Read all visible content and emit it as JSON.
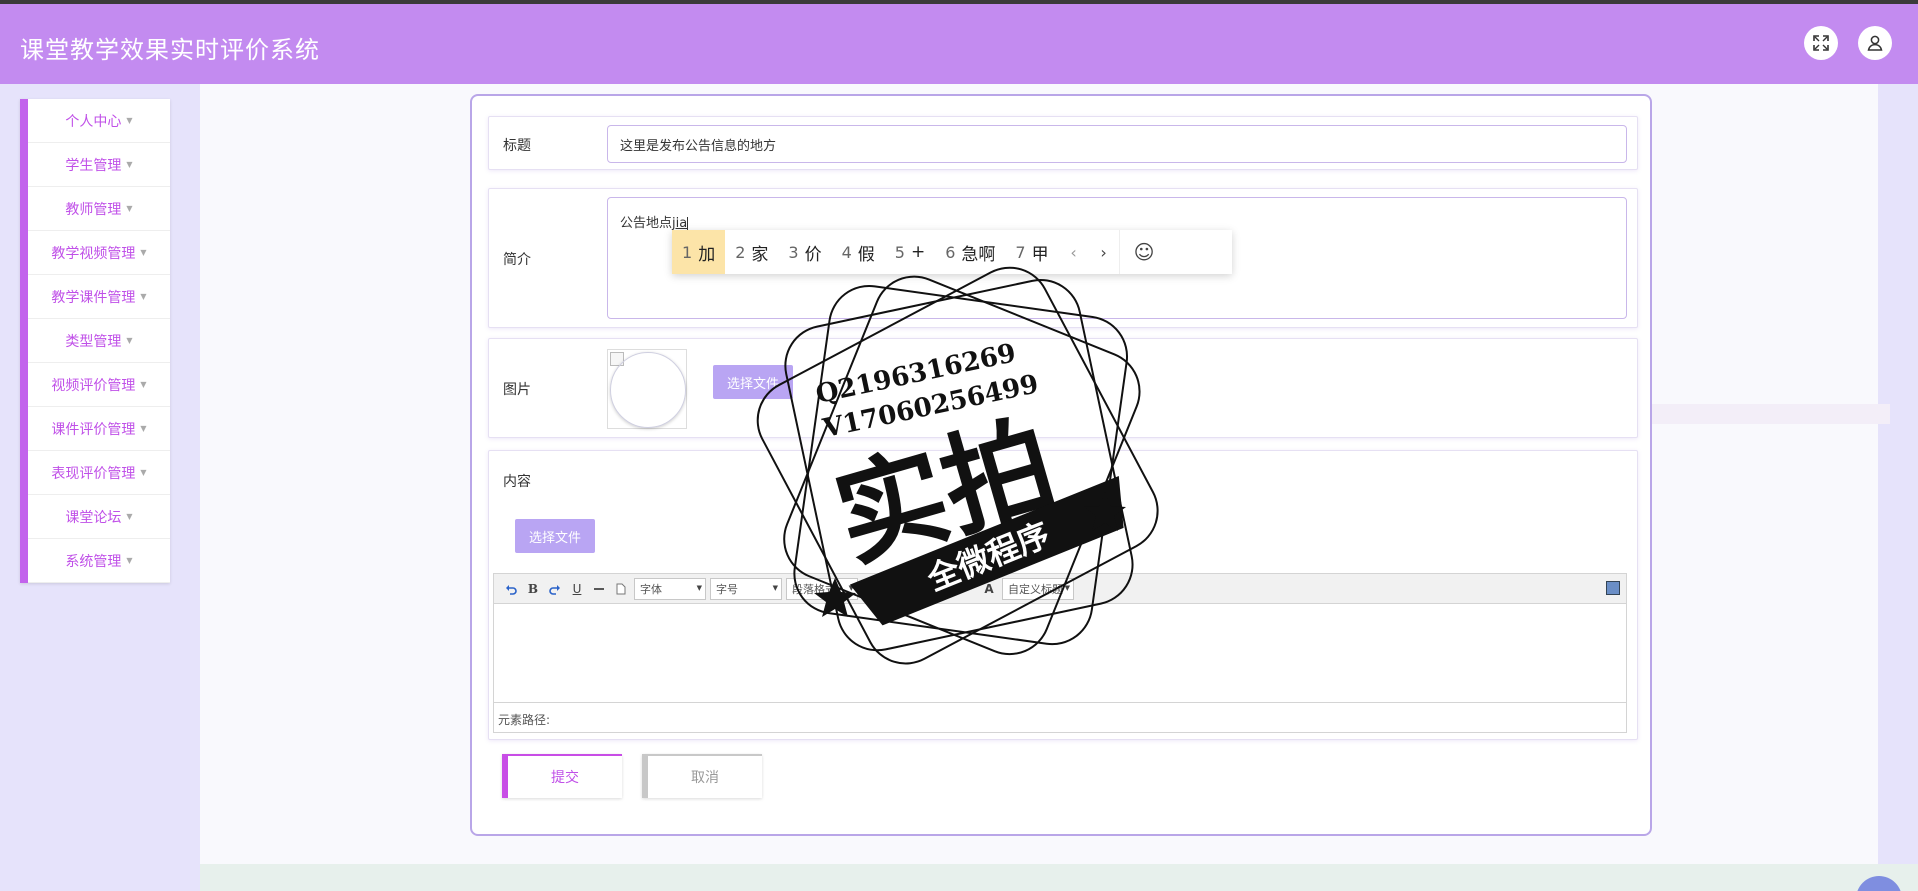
{
  "app": {
    "title": "课堂教学效果实时评价系统"
  },
  "sidebar": {
    "items": [
      {
        "label": "个人中心"
      },
      {
        "label": "学生管理"
      },
      {
        "label": "教师管理"
      },
      {
        "label": "教学视频管理"
      },
      {
        "label": "教学课件管理"
      },
      {
        "label": "类型管理"
      },
      {
        "label": "视频评价管理"
      },
      {
        "label": "课件评价管理"
      },
      {
        "label": "表现评价管理"
      },
      {
        "label": "课堂论坛"
      },
      {
        "label": "系统管理"
      }
    ]
  },
  "form": {
    "title_label": "标题",
    "title_value": "这里是发布公告信息的地方",
    "intro_label": "简介",
    "intro_value": "公告地点",
    "intro_typing": "jia",
    "image_label": "图片",
    "image_button": "选择文件",
    "content_label": "内容",
    "content_button": "选择文件",
    "submit_label": "提交",
    "cancel_label": "取消"
  },
  "editor": {
    "font_select": "字体",
    "size_select": "字号",
    "paragraph_select": "段落格式",
    "custom_heading_select": "自定义标题",
    "status_text": "元素路径:"
  },
  "ime": {
    "candidates": [
      {
        "num": "1",
        "text": "加"
      },
      {
        "num": "2",
        "text": "家"
      },
      {
        "num": "3",
        "text": "价"
      },
      {
        "num": "4",
        "text": "假"
      },
      {
        "num": "5",
        "text": "+"
      },
      {
        "num": "6",
        "text": "急啊"
      },
      {
        "num": "7",
        "text": "甲"
      }
    ],
    "selected_index": 0
  },
  "watermark": {
    "line1": "Q2196316269",
    "line2": "V17060256499",
    "main": "实拍",
    "banner": "全微程序"
  }
}
